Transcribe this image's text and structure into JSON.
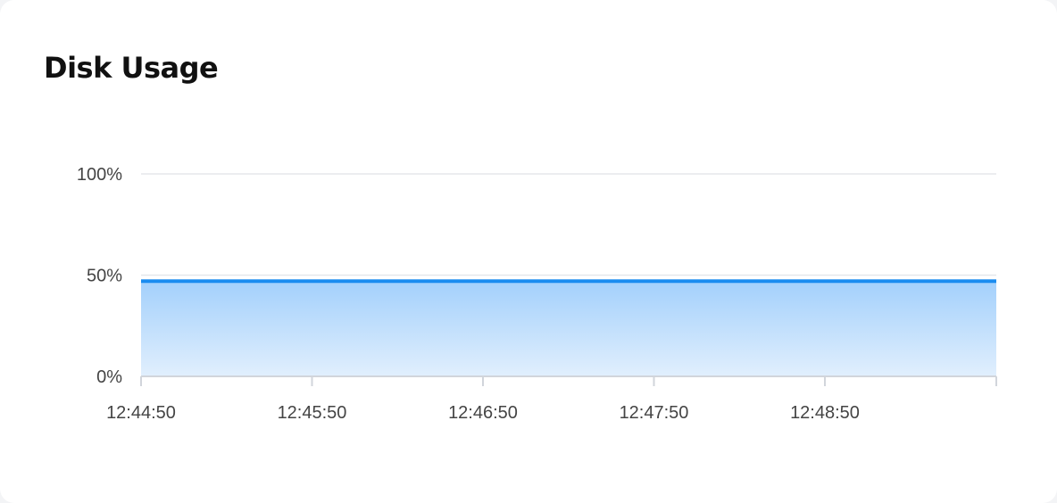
{
  "card": {
    "title": "Disk Usage"
  },
  "colors": {
    "line": "#1a8cf0",
    "area_top": "#a3d0fc",
    "area_bottom": "#e1effd",
    "grid": "#e5e7eb",
    "axis": "#d1d5db",
    "tick_text": "#444444"
  },
  "chart_data": {
    "type": "area",
    "title": "Disk Usage",
    "xlabel": "",
    "ylabel": "",
    "x_ticks": [
      "12:44:50",
      "12:45:50",
      "12:46:50",
      "12:47:50",
      "12:48:50"
    ],
    "y_ticks": [
      "0%",
      "50%",
      "100%"
    ],
    "ylim": [
      0,
      100
    ],
    "x_unit": "seconds-elapsed",
    "series": [
      {
        "values": [
          47,
          47,
          47,
          47,
          47,
          47
        ]
      }
    ],
    "grid": true,
    "legend": "none"
  }
}
